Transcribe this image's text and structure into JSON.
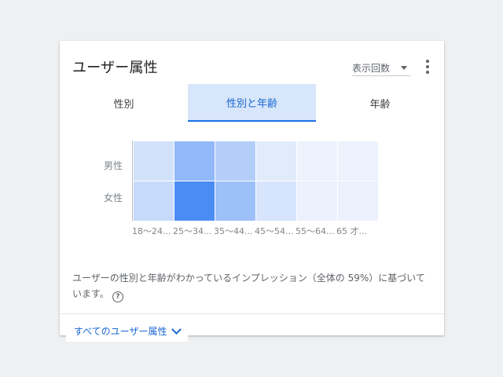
{
  "card": {
    "title": "ユーザー属性",
    "metric_select": {
      "value": "表示回数"
    },
    "more_menu_icon": "more-vert-icon"
  },
  "tabs": [
    {
      "label": "性別",
      "active": false
    },
    {
      "label": "性別と年齢",
      "active": true
    },
    {
      "label": "年齢",
      "active": false
    }
  ],
  "chart_data": {
    "type": "heatmap",
    "rows": [
      "男性",
      "女性"
    ],
    "columns": [
      "18～24...",
      "25～34...",
      "35～44...",
      "45～54...",
      "55～64...",
      "65 才..."
    ],
    "values": [
      [
        0.18,
        0.55,
        0.35,
        0.1,
        0.03,
        0.03
      ],
      [
        0.25,
        0.95,
        0.48,
        0.16,
        0.04,
        0.04
      ]
    ],
    "color_low": "#f2f6fd",
    "color_high": "#4285f4"
  },
  "note": {
    "text": "ユーザーの性別と年齢がわかっているインプレッション（全体の 59%）に基づいています。",
    "help_icon": "?"
  },
  "footer": {
    "link_label": "すべてのユーザー属性"
  },
  "colors": {
    "accent": "#1a73e8",
    "active_tab_bg": "#d7e6fa"
  }
}
